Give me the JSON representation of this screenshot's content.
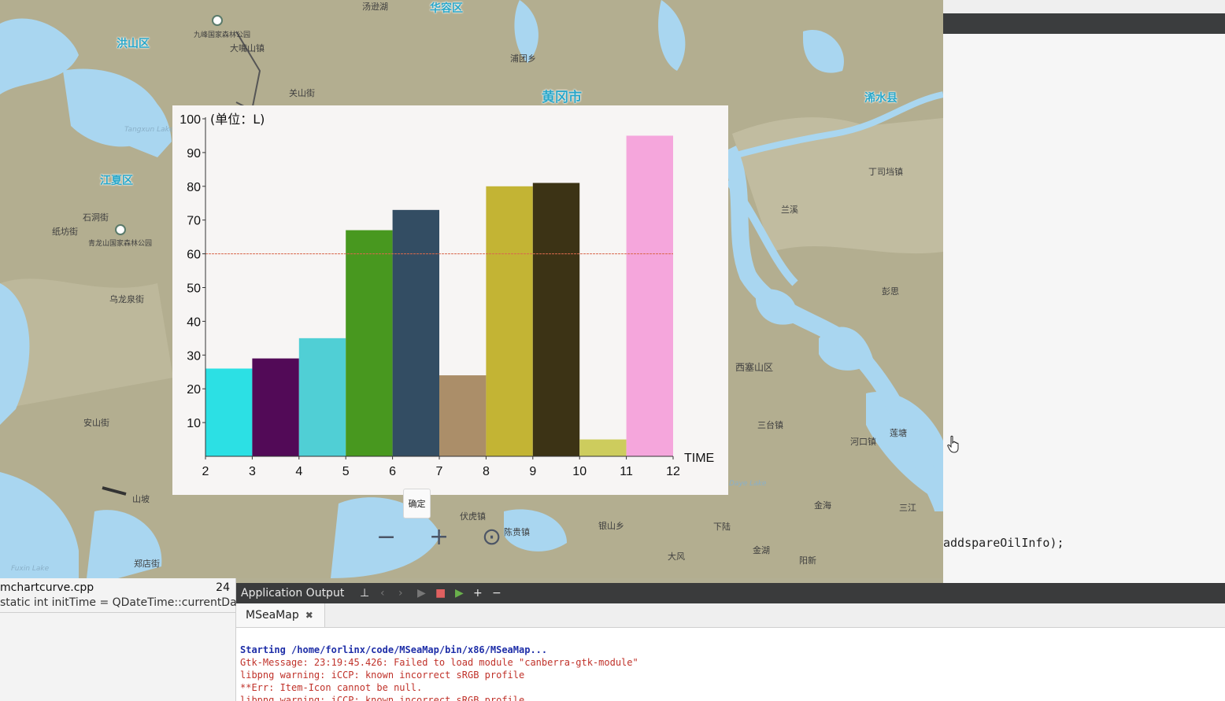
{
  "map": {
    "labels": {
      "hongshan": "洪山区",
      "jiangxia": "江夏区",
      "huarong": "华容区",
      "huanggang": "黄冈市",
      "xishui": "浠水县",
      "xisaishan": "西塞山区",
      "jiufeng": "九峰国家森林公园",
      "dalishan": "大嘴山镇",
      "tengzihu": "汤逊湖",
      "shitan": "石洞街",
      "zhifang": "纸坊街",
      "qinglongshan": "青龙山国家森林公园",
      "wulongquan": "乌龙泉街",
      "anshan": "安山街",
      "shanpo": "山坡",
      "zhenghao": "郑店街",
      "guanshan": "关山街",
      "putuan": "浦团乡",
      "lanxi": "兰溪",
      "dinghuaidu": "丁司垱镇",
      "peng": "彭思",
      "santai": "三台镇",
      "xiaoling": "下陆",
      "chenhai": "陈贵镇",
      "jinhai": "金海",
      "dafeng": "大风",
      "sanjiang": "三江",
      "jinzhou": "金湖",
      "yangxin": "阳新",
      "heqiao": "河口镇",
      "liantang": "莲塘",
      "yinshan": "银山乡",
      "futuan": "伏虎镇",
      "wuhan_lake": "Fuxin Lake",
      "dayelake": "Daye Lake",
      "tangxunlake": "Tangxun Lake"
    },
    "controls": {
      "zoom_out": "−",
      "zoom_in": "+",
      "locate": "⊙"
    }
  },
  "chart_window": {
    "confirm_label": "确定"
  },
  "chart_data": {
    "type": "bar",
    "title": "",
    "ylabel": "(单位：L)",
    "xlabel": "TIME",
    "x_ticks": [
      "2",
      "3",
      "4",
      "5",
      "6",
      "7",
      "8",
      "9",
      "10",
      "11",
      "12"
    ],
    "y_ticks": [
      10,
      20,
      30,
      40,
      50,
      60,
      70,
      80,
      90,
      100
    ],
    "ylim": [
      0,
      100
    ],
    "threshold_line": 60,
    "grid": false,
    "bars": [
      {
        "x_start": 2,
        "value": 26,
        "color": "#2ce0e4"
      },
      {
        "x_start": 3,
        "value": 29,
        "color": "#520a57"
      },
      {
        "x_start": 4,
        "value": 35,
        "color": "#50cfd5"
      },
      {
        "x_start": 5,
        "value": 67,
        "color": "#48981f"
      },
      {
        "x_start": 6,
        "value": 73,
        "color": "#334d63"
      },
      {
        "x_start": 7,
        "value": 24,
        "color": "#ab8e69"
      },
      {
        "x_start": 8,
        "value": 80,
        "color": "#c3b434"
      },
      {
        "x_start": 9,
        "value": 81,
        "color": "#3c3315"
      },
      {
        "x_start": 10,
        "value": 5,
        "color": "#cdcc5d"
      },
      {
        "x_start": 11,
        "value": 95,
        "color": "#f5a6dc"
      }
    ]
  },
  "editor": {
    "code_line": "addspareOilInfo);"
  },
  "bottom_left": {
    "file_name": "mchartcurve.cpp",
    "line_number": "24",
    "code_snippet": "static int initTime = QDateTime::currentDate"
  },
  "output": {
    "title": "Application Output",
    "toolbar": {
      "clear_icon": "⊥",
      "prev": "‹",
      "next": "›",
      "run": "▶",
      "stop": "■",
      "rerun": "▶",
      "add": "+",
      "remove": "−"
    },
    "tab_label": "MSeaMap",
    "tab_close": "✖",
    "lines": [
      "Starting /home/forlinx/code/MSeaMap/bin/x86/MSeaMap...",
      "Gtk-Message: 23:19:45.426: Failed to load module \"canberra-gtk-module\"",
      "libpng warning: iCCP: known incorrect sRGB profile",
      "**Err: Item-Icon cannot be null.",
      "libpng warning: iCCP: known incorrect sRGB profile"
    ]
  }
}
